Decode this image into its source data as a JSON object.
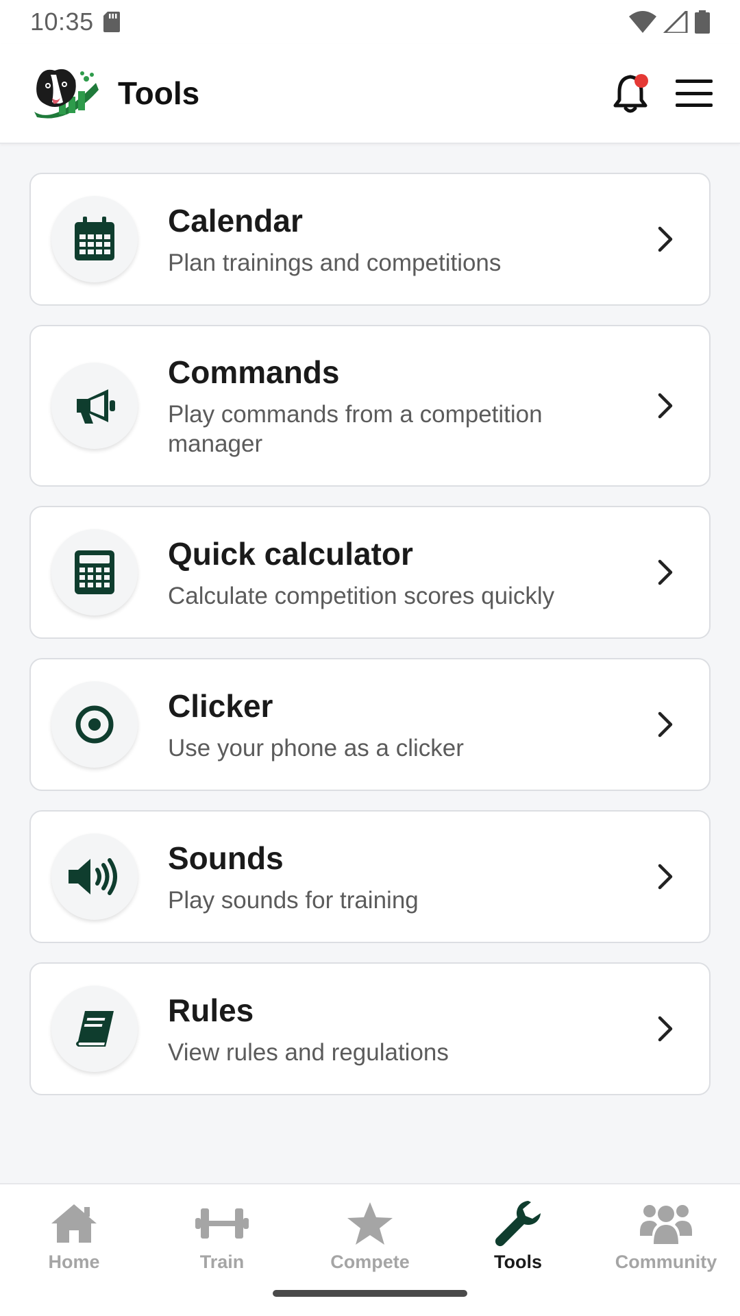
{
  "status_bar": {
    "time": "10:35"
  },
  "app_bar": {
    "title": "Tools"
  },
  "tools": [
    {
      "title": "Calendar",
      "subtitle": "Plan trainings and competitions",
      "icon": "calendar-icon"
    },
    {
      "title": "Commands",
      "subtitle": "Play commands from a competition manager",
      "icon": "megaphone-icon"
    },
    {
      "title": "Quick calculator",
      "subtitle": "Calculate competition scores quickly",
      "icon": "calculator-icon"
    },
    {
      "title": "Clicker",
      "subtitle": "Use your phone as a clicker",
      "icon": "target-icon"
    },
    {
      "title": "Sounds",
      "subtitle": "Play sounds for training",
      "icon": "speaker-icon"
    },
    {
      "title": "Rules",
      "subtitle": "View rules and regulations",
      "icon": "book-icon"
    }
  ],
  "bottom_nav": [
    {
      "label": "Home",
      "icon": "home-icon"
    },
    {
      "label": "Train",
      "icon": "dumbbell-icon"
    },
    {
      "label": "Compete",
      "icon": "star-icon"
    },
    {
      "label": "Tools",
      "icon": "wrench-icon",
      "active": true
    },
    {
      "label": "Community",
      "icon": "users-icon"
    }
  ],
  "colors": {
    "accent": "#0f3d2e",
    "inactive": "#a5a5a5",
    "notification_dot": "#e53935"
  }
}
